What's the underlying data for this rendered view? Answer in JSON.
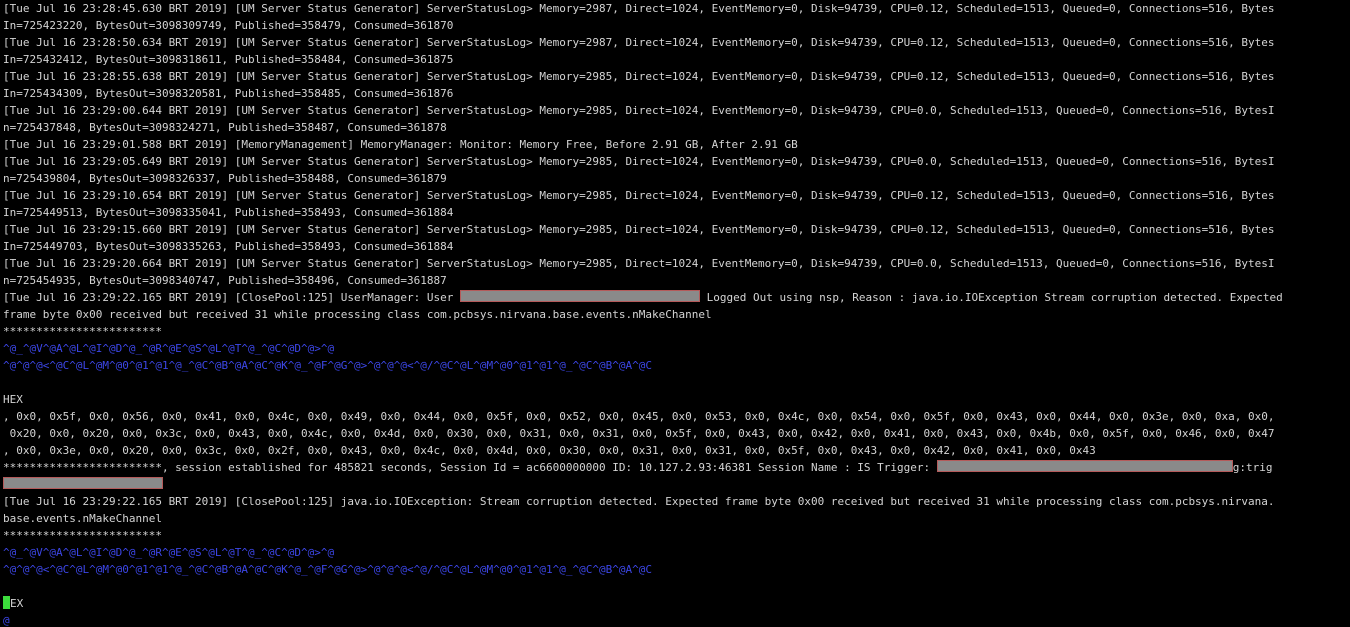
{
  "colors": {
    "background": "#000000",
    "text": "#d4d4d4",
    "control_chars": "#3c46e6",
    "redaction": "#8a8a8a",
    "cursor": "#3cdc3c"
  },
  "terminal": {
    "lines": [
      "[Tue Jul 16 23:28:45.630 BRT 2019] [UM Server Status Generator] ServerStatusLog> Memory=2987, Direct=1024, EventMemory=0, Disk=94739, CPU=0.12, Scheduled=1513, Queued=0, Connections=516, Bytes",
      "In=725423220, BytesOut=3098309749, Published=358479, Consumed=361870",
      "[Tue Jul 16 23:28:50.634 BRT 2019] [UM Server Status Generator] ServerStatusLog> Memory=2987, Direct=1024, EventMemory=0, Disk=94739, CPU=0.12, Scheduled=1513, Queued=0, Connections=516, Bytes",
      "In=725432412, BytesOut=3098318611, Published=358484, Consumed=361875",
      "[Tue Jul 16 23:28:55.638 BRT 2019] [UM Server Status Generator] ServerStatusLog> Memory=2985, Direct=1024, EventMemory=0, Disk=94739, CPU=0.12, Scheduled=1513, Queued=0, Connections=516, Bytes",
      "In=725434309, BytesOut=3098320581, Published=358485, Consumed=361876",
      "[Tue Jul 16 23:29:00.644 BRT 2019] [UM Server Status Generator] ServerStatusLog> Memory=2985, Direct=1024, EventMemory=0, Disk=94739, CPU=0.0, Scheduled=1513, Queued=0, Connections=516, BytesI",
      "n=725437848, BytesOut=3098324271, Published=358487, Consumed=361878",
      "[Tue Jul 16 23:29:01.588 BRT 2019] [MemoryManagement] MemoryManager: Monitor: Memory Free, Before 2.91 GB, After 2.91 GB",
      "[Tue Jul 16 23:29:05.649 BRT 2019] [UM Server Status Generator] ServerStatusLog> Memory=2985, Direct=1024, EventMemory=0, Disk=94739, CPU=0.0, Scheduled=1513, Queued=0, Connections=516, BytesI",
      "n=725439804, BytesOut=3098326337, Published=358488, Consumed=361879",
      "[Tue Jul 16 23:29:10.654 BRT 2019] [UM Server Status Generator] ServerStatusLog> Memory=2985, Direct=1024, EventMemory=0, Disk=94739, CPU=0.12, Scheduled=1513, Queued=0, Connections=516, Bytes",
      "In=725449513, BytesOut=3098335041, Published=358493, Consumed=361884",
      "[Tue Jul 16 23:29:15.660 BRT 2019] [UM Server Status Generator] ServerStatusLog> Memory=2985, Direct=1024, EventMemory=0, Disk=94739, CPU=0.12, Scheduled=1513, Queued=0, Connections=516, Bytes",
      "In=725449703, BytesOut=3098335263, Published=358493, Consumed=361884",
      "[Tue Jul 16 23:29:20.664 BRT 2019] [UM Server Status Generator] ServerStatusLog> Memory=2985, Direct=1024, EventMemory=0, Disk=94739, CPU=0.0, Scheduled=1513, Queued=0, Connections=516, BytesI",
      "n=725454935, BytesOut=3098340747, Published=358496, Consumed=361887"
    ],
    "logout_line": {
      "prefix": "[Tue Jul 16 23:29:22.165 BRT 2019] [ClosePool:125] UserManager: User ",
      "suffix": " Logged Out using nsp, Reason : java.io.IOException Stream corruption detected. Expected"
    },
    "logout_line_cont": "frame byte 0x00 received but received 31 while processing class com.pcbsys.nirvana.base.events.nMakeChannel",
    "stars_1": "************************",
    "ctrl_line_1": "^@_^@V^@A^@L^@I^@D^@_^@R^@E^@S^@L^@T^@_^@C^@D^@>^@",
    "ctrl_line_2": "^@^@^@<^@C^@L^@M^@0^@1^@1^@_^@C^@B^@A^@C^@K^@_^@F^@G^@>^@^@^@<^@/^@C^@L^@M^@0^@1^@1^@_^@C^@B^@A^@C",
    "hex_label": "HEX",
    "hex_lines": [
      ", 0x0, 0x5f, 0x0, 0x56, 0x0, 0x41, 0x0, 0x4c, 0x0, 0x49, 0x0, 0x44, 0x0, 0x5f, 0x0, 0x52, 0x0, 0x45, 0x0, 0x53, 0x0, 0x4c, 0x0, 0x54, 0x0, 0x5f, 0x0, 0x43, 0x0, 0x44, 0x0, 0x3e, 0x0, 0xa, 0x0,",
      " 0x20, 0x0, 0x20, 0x0, 0x3c, 0x0, 0x43, 0x0, 0x4c, 0x0, 0x4d, 0x0, 0x30, 0x0, 0x31, 0x0, 0x31, 0x0, 0x5f, 0x0, 0x43, 0x0, 0x42, 0x0, 0x41, 0x0, 0x43, 0x0, 0x4b, 0x0, 0x5f, 0x0, 0x46, 0x0, 0x47",
      ", 0x0, 0x3e, 0x0, 0x20, 0x0, 0x3c, 0x0, 0x2f, 0x0, 0x43, 0x0, 0x4c, 0x0, 0x4d, 0x0, 0x30, 0x0, 0x31, 0x0, 0x31, 0x0, 0x5f, 0x0, 0x43, 0x0, 0x42, 0x0, 0x41, 0x0, 0x43"
    ],
    "session_line": {
      "prefix": "************************, session established for 485821 seconds, Session Id = ac6600000000 ID: 10.127.2.93:46381 Session Name : IS Trigger: ",
      "suffix": "g:trig"
    },
    "blank": "",
    "exception_line": "[Tue Jul 16 23:29:22.165 BRT 2019] [ClosePool:125] java.io.IOException: Stream corruption detected. Expected frame byte 0x00 received but received 31 while processing class com.pcbsys.nirvana.",
    "exception_line_cont": "base.events.nMakeChannel",
    "stars_2": "************************",
    "ctrl_line_3": "^@_^@V^@A^@L^@I^@D^@_^@R^@E^@S^@L^@T^@_^@C^@D^@>^@",
    "ctrl_line_4": "^@^@^@<^@C^@L^@M^@0^@1^@1^@_^@C^@B^@A^@C^@K^@_^@F^@G^@>^@^@^@<^@/^@C^@L^@M^@0^@1^@1^@_^@C^@B^@A^@C",
    "hex_label_2": "EX",
    "last_char": "@"
  }
}
